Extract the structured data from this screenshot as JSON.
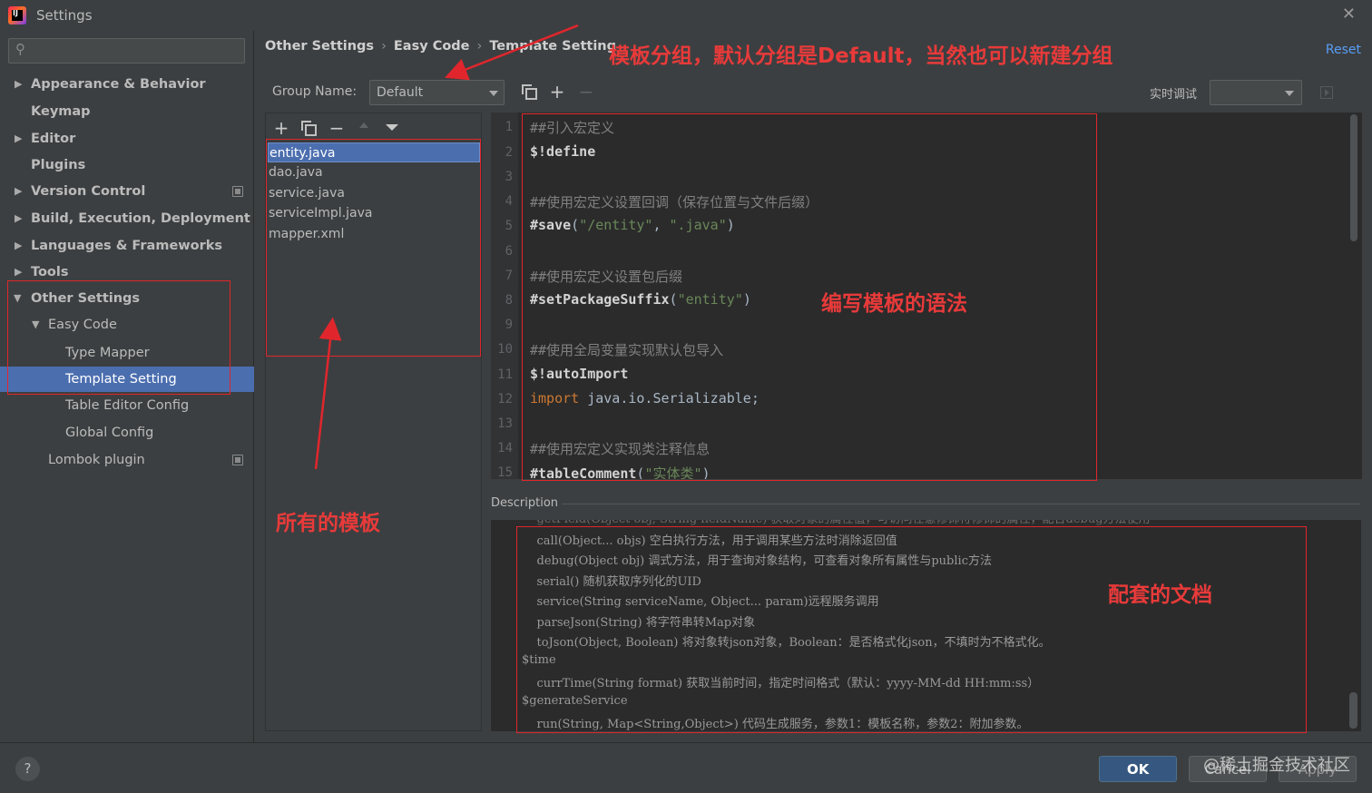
{
  "window": {
    "title": "Settings",
    "close_glyph": "✕",
    "app_icon": "intellij-idea-icon"
  },
  "sidebar": {
    "search_placeholder": "",
    "items": [
      {
        "label": "Appearance & Behavior",
        "arrow": "▶"
      },
      {
        "label": "Keymap"
      },
      {
        "label": "Editor",
        "arrow": "▶"
      },
      {
        "label": "Plugins"
      },
      {
        "label": "Version Control",
        "arrow": "▶"
      },
      {
        "label": "Build, Execution, Deployment",
        "arrow": "▶"
      },
      {
        "label": "Languages & Frameworks",
        "arrow": "▶"
      },
      {
        "label": "Tools",
        "arrow": "▶"
      },
      {
        "label": "Other Settings",
        "arrow": "▼"
      },
      {
        "label": "Easy Code",
        "arrow": "▼"
      },
      {
        "label": "Type Mapper"
      },
      {
        "label": "Template Setting"
      },
      {
        "label": "Table Editor Config"
      },
      {
        "label": "Global Config"
      },
      {
        "label": "Lombok plugin"
      }
    ]
  },
  "header": {
    "breadcrumb": [
      "Other Settings",
      "Easy Code",
      "Template Setting"
    ],
    "breadcrumb_sep": "›",
    "reset_label": "Reset"
  },
  "group": {
    "label": "Group Name:",
    "value": "Default",
    "debug_label": "实时调试",
    "debug_value": ""
  },
  "files": {
    "toolbar": {
      "add": "+",
      "remove": "−"
    },
    "items": [
      "entity.java",
      "dao.java",
      "service.java",
      "serviceImpl.java",
      "mapper.xml"
    ],
    "selected": "entity.java"
  },
  "editor": {
    "line_numbers": [
      "1",
      "2",
      "3",
      "4",
      "5",
      "6",
      "7",
      "8",
      "9",
      "10",
      "11",
      "12",
      "13",
      "14",
      "15"
    ],
    "lines": [
      {
        "comment": "##引入宏定义"
      },
      {
        "var": "$!define"
      },
      {},
      {
        "comment": "##使用宏定义设置回调（保存位置与文件后缀）"
      },
      {
        "var": "#save",
        "p1": "(",
        "s1": "\"/entity\"",
        "p2": ", ",
        "s2": "\".java\"",
        "p3": ")"
      },
      {},
      {
        "comment": "##使用宏定义设置包后缀"
      },
      {
        "var": "#setPackageSuffix",
        "p1": "(",
        "s1": "\"entity\"",
        "p3": ")"
      },
      {},
      {
        "comment": "##使用全局变量实现默认包导入"
      },
      {
        "var": "$!autoImport"
      },
      {
        "kw": "import",
        "p1": " java.io.Serializable;"
      },
      {},
      {
        "comment": "##使用宏定义实现类注释信息"
      },
      {
        "var": "#tableComment",
        "p1": "(",
        "s1": "\"实体类\"",
        "p3": ")"
      }
    ]
  },
  "description": {
    "label": "Description",
    "lines": [
      "    call(Object... objs) 空白执行方法，用于调用某些方法时消除返回值",
      "    debug(Object obj) 调式方法，用于查询对象结构，可查看对象所有属性与public方法",
      "    serial() 随机获取序列化的UID",
      "    service(String serviceName, Object... param)远程服务调用",
      "    parseJson(String) 将字符串转Map对象",
      "    toJson(Object, Boolean) 将对象转json对象，Boolean：是否格式化json，不填时为不格式化。",
      "$time",
      "    currTime(String format) 获取当前时间，指定时间格式（默认：yyyy-MM-dd HH:mm:ss）",
      "$generateService",
      "    run(String, Map<String,Object>) 代码生成服务，参数1：模板名称，参数2：附加参数。"
    ]
  },
  "footer": {
    "help": "?",
    "ok": "OK",
    "cancel": "Cancel",
    "apply": "Apply",
    "watermark": "@稀土掘金技术社区"
  },
  "annotations": {
    "group_note": "模板分组，默认分组是Default，当然也可以新建分组",
    "syntax_note": "编写模板的语法",
    "templates_note": "所有的模板",
    "docs_note": "配套的文档"
  },
  "colors": {
    "annotation": "#e0262c",
    "selection": "#4b6eaf",
    "accent": "#589df6"
  }
}
